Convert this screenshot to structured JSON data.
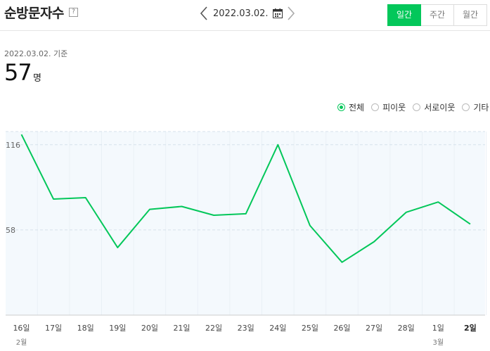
{
  "header": {
    "title": "순방문자수",
    "help_label": "?",
    "date": "2022.03.02.",
    "prev_icon": "chevron-left-icon",
    "next_icon": "chevron-right-icon",
    "calendar_icon": "calendar-icon",
    "periods": [
      {
        "label": "일간",
        "active": true
      },
      {
        "label": "주간",
        "active": false
      },
      {
        "label": "월간",
        "active": false
      }
    ]
  },
  "summary": {
    "basis": "2022.03.02. 기준",
    "value": "57",
    "unit": "명"
  },
  "filters": [
    {
      "label": "전체",
      "checked": true
    },
    {
      "label": "피이웃",
      "checked": false
    },
    {
      "label": "서로이웃",
      "checked": false
    },
    {
      "label": "기타",
      "checked": false
    }
  ],
  "colors": {
    "accent": "#03c75a",
    "plot_bg": "#f4f9fd"
  },
  "chart_data": {
    "type": "line",
    "categories": [
      "16일",
      "17일",
      "18일",
      "19일",
      "20일",
      "21일",
      "22일",
      "23일",
      "24일",
      "25일",
      "26일",
      "27일",
      "28일",
      "1일",
      "2일"
    ],
    "month_labels": [
      {
        "index": 0,
        "label": "2월"
      },
      {
        "index": 13,
        "label": "3월"
      }
    ],
    "series": [
      {
        "values": [
          123,
          79,
          80,
          46,
          72,
          74,
          68,
          69,
          116,
          61,
          36,
          50,
          70,
          77,
          62
        ]
      }
    ],
    "yticks": [
      58,
      116
    ],
    "ylim": [
      0,
      125
    ],
    "highlight_category": "2일",
    "grid": true
  }
}
